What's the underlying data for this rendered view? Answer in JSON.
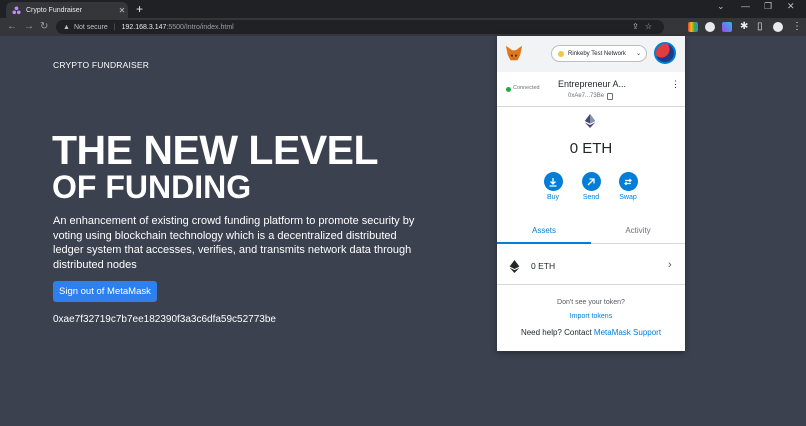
{
  "browser": {
    "tab_title": "Crypto Fundraiser",
    "new_tab_label": "+",
    "url_warning": "Not secure",
    "url_host": "192.168.3.147",
    "url_path": ":5500/Intro/index.html"
  },
  "page": {
    "brand": "CRYPTO FUNDRAISER",
    "hero_line1": "THE NEW LEVEL",
    "hero_line2": "OF FUNDING",
    "description": "An enhancement of existing crowd funding platform to promote security by voting using blockchain technology which is a decentralized distributed ledger system that accesses, verifies, and transmits network data through distributed nodes",
    "signout_label": "Sign out of MetaMask",
    "wallet_address": "0xae7f32719c7b7ee182390f3a3c6dfa59c52773be"
  },
  "metamask": {
    "network": "Rinkeby Test Network",
    "connection_status": "Connected",
    "account_name": "Entrepreneur A...",
    "account_address": "0xAe7...73Be",
    "balance": "0 ETH",
    "actions": [
      {
        "label": "Buy",
        "icon": "download-icon"
      },
      {
        "label": "Send",
        "icon": "arrow-up-right-icon"
      },
      {
        "label": "Swap",
        "icon": "swap-icon"
      }
    ],
    "tabs": [
      "Assets",
      "Activity"
    ],
    "active_tab": "Assets",
    "asset_amount": "0 ETH",
    "dont_see_token": "Don't see your token?",
    "import_tokens": "Import tokens",
    "help_prefix": "Need help? Contact",
    "help_link": "MetaMask Support"
  },
  "colors": {
    "page_bg": "#3c4150",
    "signout_button": "#2f80ed",
    "metamask_blue": "#037dd6",
    "network_dot": "#f6c343",
    "connected_dot": "#28a745"
  }
}
